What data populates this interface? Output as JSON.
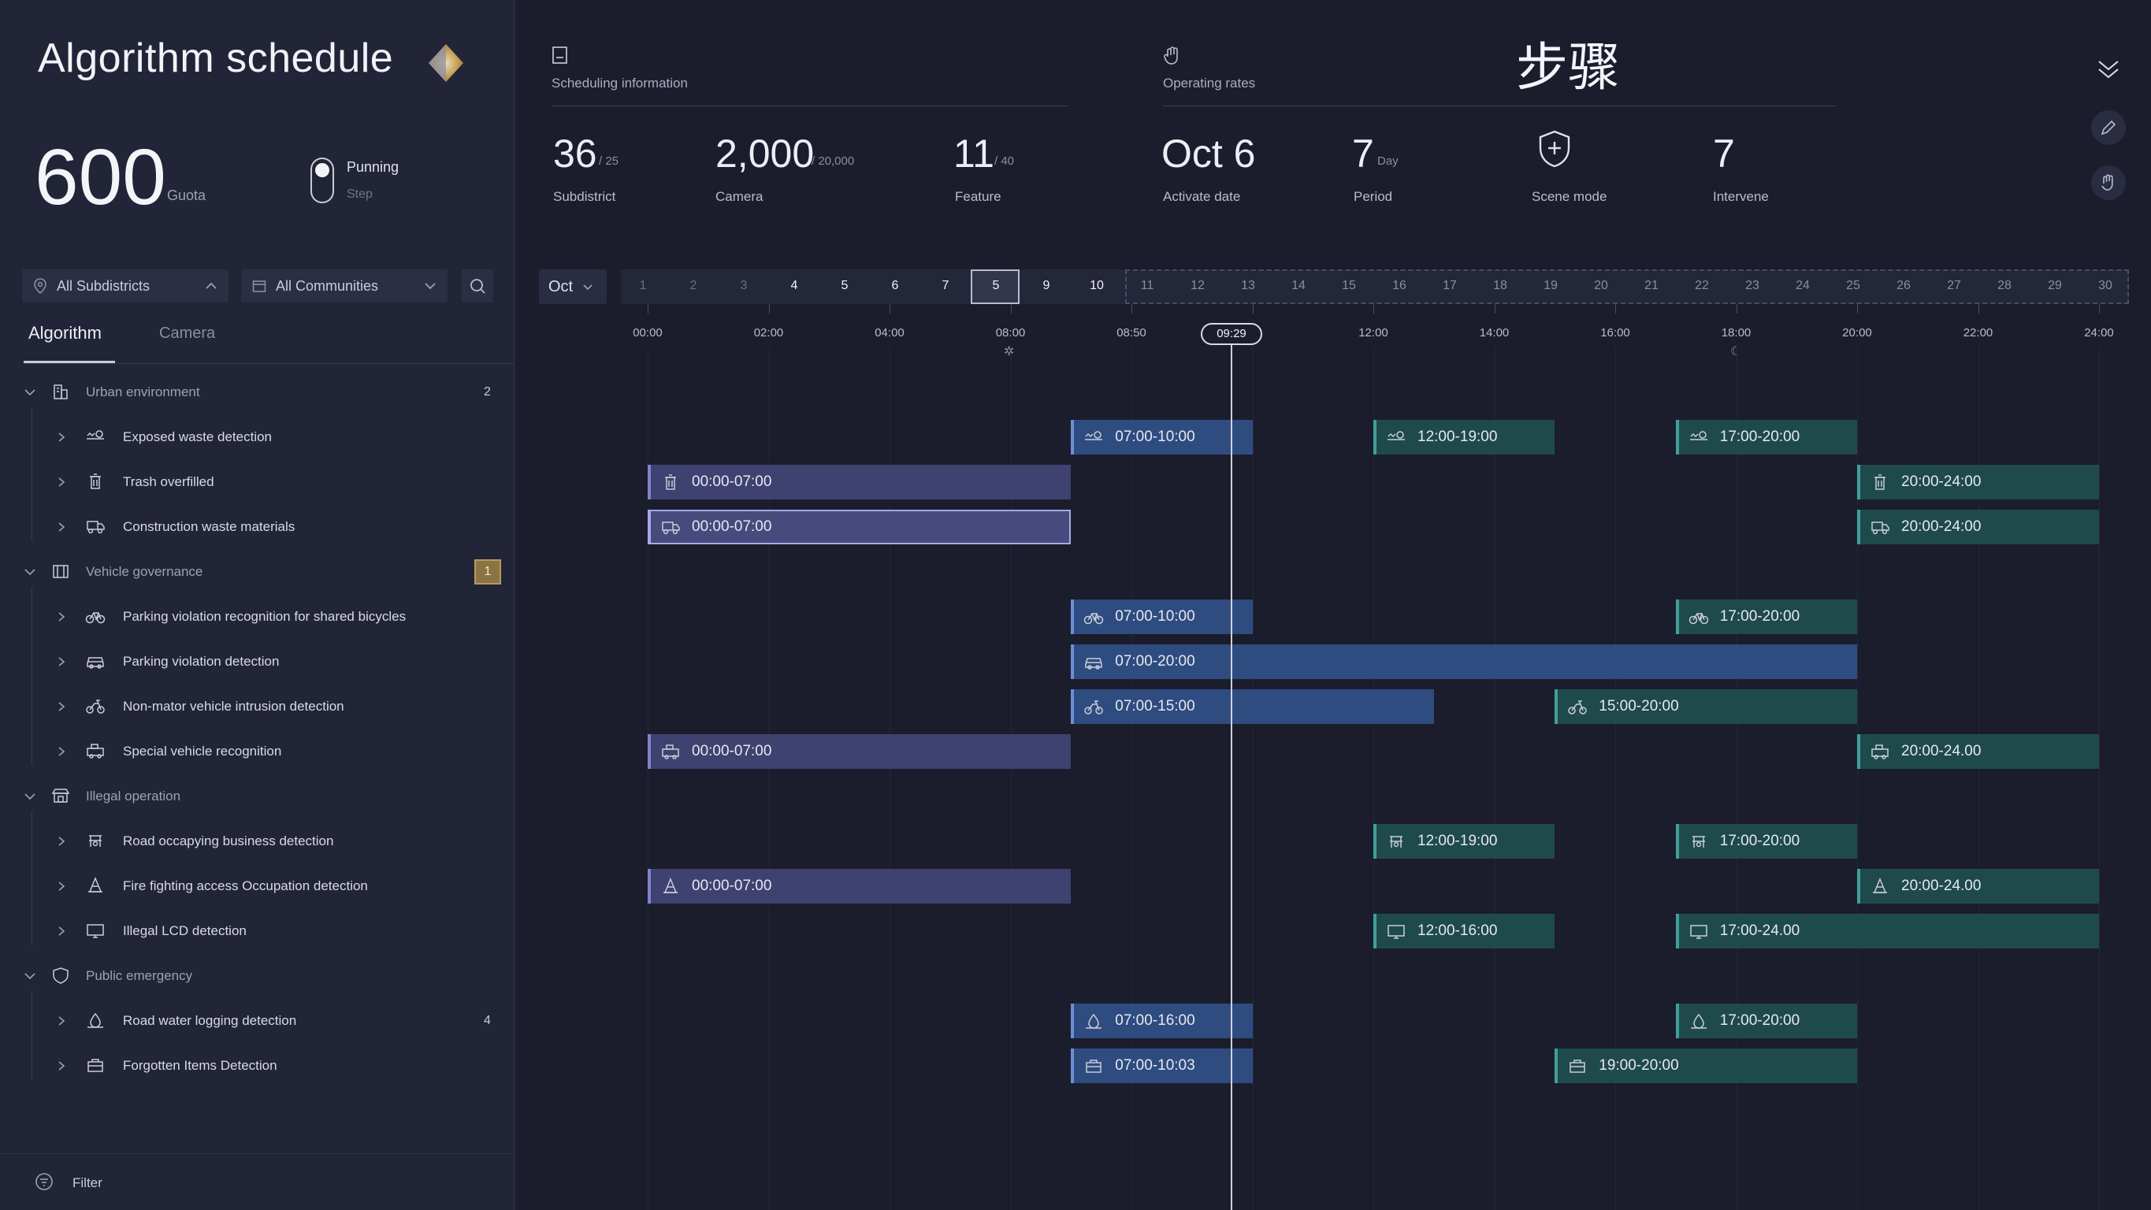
{
  "app": {
    "title": "Algorithm schedule"
  },
  "quota": {
    "value": "600",
    "label": "Guota"
  },
  "run": {
    "label": "Punning",
    "step": "Step"
  },
  "filters": {
    "subdistricts": "All Subdistricts",
    "communities": "All Communities"
  },
  "tabs": {
    "algorithm": "Algorithm",
    "camera": "Camera"
  },
  "tree": {
    "groups": [
      {
        "label": "Urban environment",
        "count": "2",
        "icon": "building-icon",
        "items": [
          {
            "label": "Exposed waste detection",
            "icon": "waste-icon"
          },
          {
            "label": "Trash overfilled",
            "icon": "trash-icon"
          },
          {
            "label": "Construction waste materials",
            "icon": "construction-truck-icon"
          }
        ]
      },
      {
        "label": "Vehicle governance",
        "count": "1",
        "icon": "vehicle-gov-icon",
        "items": [
          {
            "label": "Parking violation recognition for shared bicycles",
            "icon": "bicycle-icon"
          },
          {
            "label": "Parking violation detection",
            "icon": "car-icon"
          },
          {
            "label": "Non-mator vehicle intrusion detection",
            "icon": "scooter-icon"
          },
          {
            "label": "Special vehicle recognition",
            "icon": "special-vehicle-icon"
          }
        ]
      },
      {
        "label": "Illegal operation",
        "count": "",
        "icon": "shop-icon",
        "items": [
          {
            "label": "Road occapying business detection",
            "icon": "stall-icon"
          },
          {
            "label": "Fire fighting access Occupation detection",
            "icon": "cone-icon"
          },
          {
            "label": "Illegal LCD detection",
            "icon": "lcd-icon"
          }
        ]
      },
      {
        "label": "Public emergency",
        "count": "",
        "icon": "shield-icon",
        "items": [
          {
            "label": "Road water logging detection",
            "icon": "water-icon",
            "count": "4"
          },
          {
            "label": "Forgotten Items Detection",
            "icon": "bag-icon"
          }
        ]
      }
    ]
  },
  "filter_label": "Filter",
  "header": {
    "scheduling": {
      "title": "Scheduling information",
      "stats": [
        {
          "value": "36",
          "sub": "/ 25",
          "label": "Subdistrict"
        },
        {
          "value": "2,000",
          "sub": "/ 20,000",
          "label": "Camera"
        },
        {
          "value": "11",
          "sub": "/ 40",
          "label": "Feature"
        }
      ]
    },
    "operating": {
      "title": "Operating rates",
      "cjk": "步骤",
      "activate": {
        "value": "Oct 6",
        "label": "Activate date"
      },
      "period": {
        "value": "7",
        "sub": "Day",
        "label": "Period"
      },
      "scene": {
        "label": "Scene mode"
      },
      "intervene": {
        "value": "7",
        "label": "Intervene"
      }
    }
  },
  "timeline": {
    "month": "Oct",
    "days": [
      "1",
      "2",
      "3",
      "4",
      "5",
      "6",
      "7",
      "5",
      "9",
      "10",
      "11",
      "12",
      "13",
      "14",
      "15",
      "16",
      "17",
      "18",
      "19",
      "20",
      "21",
      "22",
      "23",
      "24",
      "25",
      "26",
      "27",
      "28",
      "29",
      "30"
    ],
    "selected_day_index": 7,
    "hours": [
      "00:00",
      "02:00",
      "04:00",
      "08:00",
      "08:50",
      "12:00",
      "14:00",
      "16:00",
      "18:00",
      "20:00",
      "22:00",
      "24:00"
    ],
    "now": "09:29"
  },
  "schedule": [
    {
      "row": 0,
      "bars": [
        {
          "label": "07:00-10:00",
          "color": "blue",
          "start": 7,
          "end": 10
        },
        {
          "label": "12:00-19:00",
          "color": "teal",
          "start": 12,
          "end": 15
        },
        {
          "label": "17:00-20:00",
          "color": "teal",
          "start": 17,
          "end": 20
        }
      ]
    },
    {
      "row": 1,
      "bars": [
        {
          "label": "00:00-07:00",
          "color": "purple",
          "start": 0,
          "end": 7
        },
        {
          "label": "20:00-24:00",
          "color": "teal",
          "start": 20,
          "end": 24
        }
      ]
    },
    {
      "row": 2,
      "bars": [
        {
          "label": "00:00-07:00",
          "color": "purple",
          "start": 0,
          "end": 7,
          "selected": true
        },
        {
          "label": "20:00-24:00",
          "color": "teal",
          "start": 20,
          "end": 24
        }
      ]
    },
    {
      "row": 3,
      "bars": []
    },
    {
      "row": 4,
      "bars": [
        {
          "label": "07:00-10:00",
          "color": "blue",
          "start": 7,
          "end": 10
        },
        {
          "label": "17:00-20:00",
          "color": "teal",
          "start": 17,
          "end": 20
        }
      ]
    },
    {
      "row": 5,
      "bars": [
        {
          "label": "07:00-20:00",
          "color": "blue",
          "start": 7,
          "end": 20
        }
      ]
    },
    {
      "row": 6,
      "bars": [
        {
          "label": "07:00-15:00",
          "color": "blue",
          "start": 7,
          "end": 13
        },
        {
          "label": "15:00-20:00",
          "color": "teal",
          "start": 15,
          "end": 20
        }
      ]
    },
    {
      "row": 7,
      "bars": [
        {
          "label": "00:00-07:00",
          "color": "purple",
          "start": 0,
          "end": 7
        },
        {
          "label": "20:00-24.00",
          "color": "teal",
          "start": 20,
          "end": 24
        }
      ]
    },
    {
      "row": 8,
      "bars": []
    },
    {
      "row": 9,
      "bars": [
        {
          "label": "12:00-19:00",
          "color": "teal",
          "start": 12,
          "end": 15
        },
        {
          "label": "17:00-20:00",
          "color": "teal",
          "start": 17,
          "end": 20
        }
      ]
    },
    {
      "row": 10,
      "bars": [
        {
          "label": "00:00-07:00",
          "color": "purple",
          "start": 0,
          "end": 7
        },
        {
          "label": "20:00-24.00",
          "color": "teal",
          "start": 20,
          "end": 24
        }
      ]
    },
    {
      "row": 11,
      "bars": [
        {
          "label": "12:00-16:00",
          "color": "teal",
          "start": 12,
          "end": 15
        },
        {
          "label": "17:00-24.00",
          "color": "teal",
          "start": 17,
          "end": 24
        }
      ]
    },
    {
      "row": 12,
      "bars": []
    },
    {
      "row": 13,
      "bars": [
        {
          "label": "07:00-16:00",
          "color": "blue",
          "start": 7,
          "end": 10
        },
        {
          "label": "17:00-20:00",
          "color": "teal",
          "start": 17,
          "end": 20
        }
      ]
    },
    {
      "row": 14,
      "bars": [
        {
          "label": "07:00-10:03",
          "color": "blue",
          "start": 7,
          "end": 10
        },
        {
          "label": "19:00-20:00",
          "color": "teal",
          "start": 15,
          "end": 20
        }
      ]
    }
  ],
  "colors": {
    "accent_purple": "#7f83d0",
    "accent_blue": "#6b8fd6",
    "accent_teal": "#3fa09a",
    "badge": "#8a7445"
  }
}
